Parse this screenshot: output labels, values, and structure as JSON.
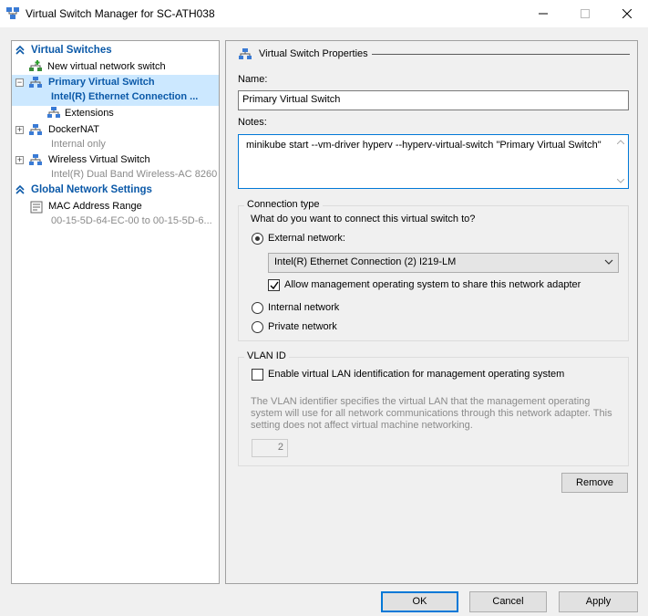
{
  "window": {
    "title": "Virtual Switch Manager for SC-ATH038"
  },
  "tree": {
    "virtual_switches_header": "Virtual Switches",
    "new_switch": "New virtual network switch",
    "primary_switch": {
      "name": "Primary Virtual Switch",
      "subtitle": "Intel(R) Ethernet Connection ...",
      "expander": "−"
    },
    "extensions": "Extensions",
    "docker_nat": {
      "name": "DockerNAT",
      "subtitle": "Internal only",
      "expander": "+"
    },
    "wireless_switch": {
      "name": "Wireless Virtual Switch",
      "subtitle": "Intel(R) Dual Band Wireless-AC 8260",
      "expander": "+"
    },
    "global_header": "Global Network Settings",
    "mac_range": {
      "name": "MAC Address Range",
      "subtitle": "00-15-5D-64-EC-00 to 00-15-5D-6..."
    }
  },
  "properties": {
    "header": "Virtual Switch Properties",
    "name_label": "Name:",
    "name_value": "Primary Virtual Switch",
    "notes_label": "Notes:",
    "notes_value": "minikube start --vm-driver hyperv --hyperv-virtual-switch \"Primary Virtual Switch\"",
    "connection_type": {
      "title": "Connection type",
      "question": "What do you want to connect this virtual switch to?",
      "external_label": "External network:",
      "adapter_selected": "Intel(R) Ethernet Connection (2) I219-LM",
      "allow_mgmt_label": "Allow management operating system to share this network adapter",
      "internal_label": "Internal network",
      "private_label": "Private network"
    },
    "vlan": {
      "title": "VLAN ID",
      "enable_label": "Enable virtual LAN identification for management operating system",
      "description": "The VLAN identifier specifies the virtual LAN that the management operating system will use for all network communications through this network adapter. This setting does not affect virtual machine networking.",
      "value": "2"
    },
    "remove_label": "Remove"
  },
  "footer": {
    "ok_label": "OK",
    "cancel_label": "Cancel",
    "apply_label": "Apply"
  },
  "colors": {
    "accent": "#0078d7",
    "section_header": "#0b59a8",
    "selection": "#cce8ff"
  }
}
